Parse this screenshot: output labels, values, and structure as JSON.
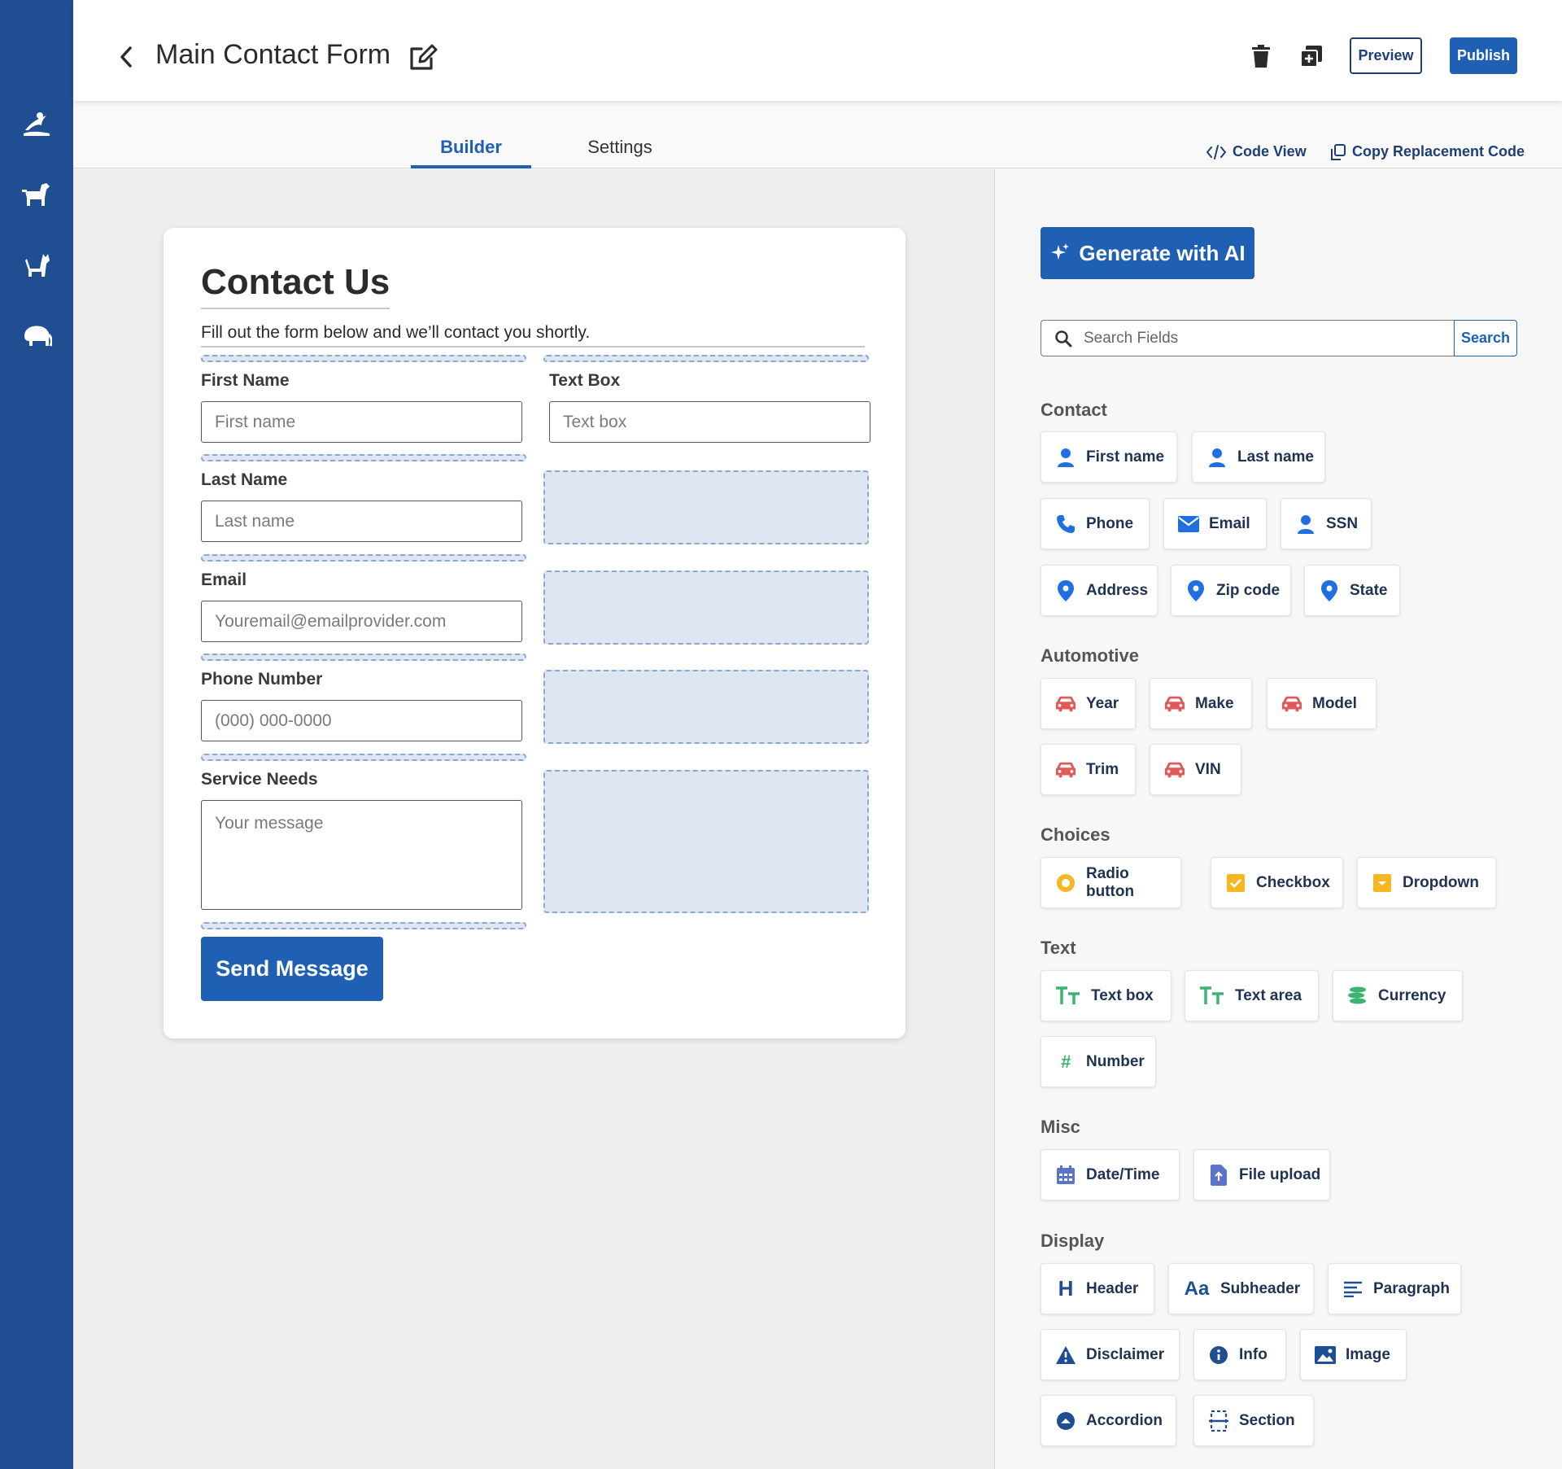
{
  "header": {
    "title": "Main Contact Form",
    "preview_label": "Preview",
    "publish_label": "Publish"
  },
  "tabs": {
    "builder": "Builder",
    "settings": "Settings",
    "code_view": "Code View",
    "copy_code": "Copy Replacement Code"
  },
  "form": {
    "title": "Contact Us",
    "description": "Fill out the form below and we’ll contact you shortly.",
    "fields": {
      "first_name": {
        "label": "First Name",
        "placeholder": "First name"
      },
      "text_box": {
        "label": "Text Box",
        "placeholder": "Text box"
      },
      "last_name": {
        "label": "Last Name",
        "placeholder": "Last name"
      },
      "email": {
        "label": "Email",
        "placeholder": "Youremail@emailprovider.com"
      },
      "phone": {
        "label": "Phone Number",
        "placeholder": "(000) 000-0000"
      },
      "service": {
        "label": "Service Needs",
        "placeholder": "Your message"
      }
    },
    "submit_label": "Send Message"
  },
  "panel": {
    "ai_label": "Generate with AI",
    "search_placeholder": "Search Fields",
    "search_button": "Search",
    "sections": {
      "contact": {
        "title": "Contact",
        "items": [
          "First name",
          "Last name",
          "Phone",
          "Email",
          "SSN",
          "Address",
          "Zip code",
          "State"
        ]
      },
      "automotive": {
        "title": "Automotive",
        "items": [
          "Year",
          "Make",
          "Model",
          "Trim",
          "VIN"
        ]
      },
      "choices": {
        "title": "Choices",
        "items": [
          "Radio button",
          "Checkbox",
          "Dropdown"
        ]
      },
      "text": {
        "title": "Text",
        "items": [
          "Text box",
          "Text area",
          "Currency",
          "Number"
        ]
      },
      "misc": {
        "title": "Misc",
        "items": [
          "Date/Time",
          "File upload"
        ]
      },
      "display": {
        "title": "Display",
        "items": [
          "Header",
          "Subheader",
          "Paragraph",
          "Disclaimer",
          "Info",
          "Image",
          "Accordion",
          "Section"
        ]
      }
    }
  },
  "colors": {
    "sidebar": "#1f4e93",
    "primary": "#1f5fb4",
    "contact_icon": "#1f6fe0",
    "auto_icon": "#e05a5a",
    "choice_icon": "#f5b822",
    "text_icon": "#3cb371"
  }
}
